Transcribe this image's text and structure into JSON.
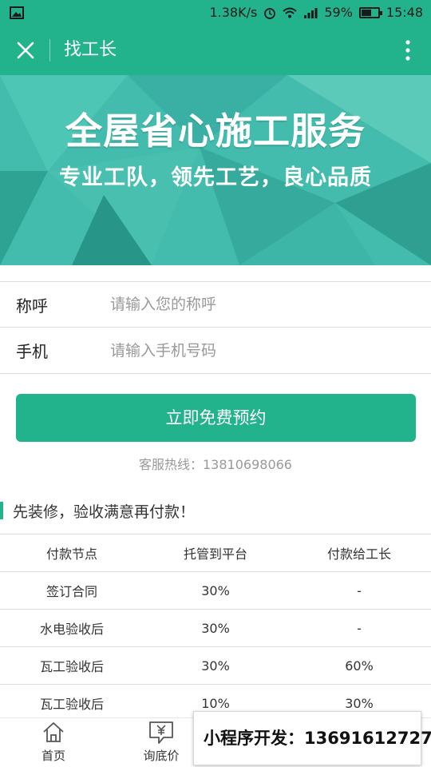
{
  "status_bar": {
    "network_speed": "1.38K/s",
    "battery_percent": "59%",
    "battery_level": 0.59,
    "time": "15:48"
  },
  "title_bar": {
    "title": "找工长"
  },
  "banner": {
    "headline": "全屋省心施工服务",
    "subline": "专业工队，领先工艺，良心品质"
  },
  "form": {
    "name_label": "称呼",
    "name_placeholder": "请输入您的称呼",
    "name_value": "",
    "phone_label": "手机",
    "phone_placeholder": "请输入手机号码",
    "phone_value": ""
  },
  "submit_label": "立即免费预约",
  "hotline": "客服热线：13810698066",
  "section_title": "先装修，验收满意再付款！",
  "payment_table": {
    "headers": [
      "付款节点",
      "托管到平台",
      "付款给工长"
    ],
    "rows": [
      [
        "签订合同",
        "30%",
        "-"
      ],
      [
        "水电验收后",
        "30%",
        "-"
      ],
      [
        "瓦工验收后",
        "30%",
        "60%"
      ],
      [
        "瓦工验收后",
        "10%",
        "30%"
      ]
    ]
  },
  "bottom_nav": {
    "home_label": "首页",
    "quote_label": "询底价"
  },
  "promo_text": "小程序开发：13691612727",
  "colors": {
    "brand": "#23b38c",
    "banner": "#3fb9ab"
  }
}
